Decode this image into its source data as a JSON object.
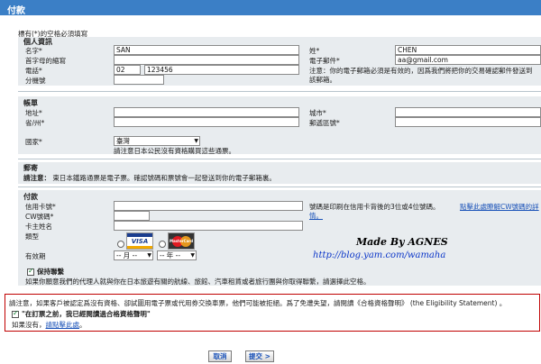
{
  "title": "付款",
  "required_note": "標有(*)的空格必須填寫",
  "personal": {
    "section_title": "個人資訊",
    "first_name_label": "名字*",
    "first_name_value": "SAN",
    "initial_label": "首字母的縮寫",
    "phone_label": "電話*",
    "phone_area": "02",
    "phone_number": "123456",
    "ext_label": "分機號",
    "last_name_label": "姓*",
    "last_name_value": "CHEN",
    "email_label": "電子郵件*",
    "email_value": "aa@gmail.com",
    "email_note_a": "注意：你的電子郵箱必須是有效的，因爲我們將把你的交易確認郵件發送到",
    "email_note_b": "該郵箱。"
  },
  "billing": {
    "section_title": "帳單",
    "address_label": "地址*",
    "province_label": "省/州*",
    "city_label": "城市*",
    "postal_label": "郵遞區號*",
    "country_label": "國家*",
    "country_value": "臺灣",
    "country_note": "請注意日本公民沒有資格購買這些通票。"
  },
  "delivery": {
    "section_title": "郵寄",
    "note_bold": "請注意：",
    "note_text": "東日本鐵路通票是電子票。確認號碼和票號會一起發送到你的電子郵箱裏。"
  },
  "payment": {
    "section_title": "付款",
    "card_number_label": "信用卡號*",
    "cvv_label": "CW號碼*",
    "card_name_label": "卡主姓名",
    "card_type_label": "類型",
    "expiry_label": "有效期",
    "month_placeholder": "-- 月 --",
    "year_placeholder": "-- 年 --",
    "cvv_note": "號碼是印刷在信用卡背後的3位或4位號碼。",
    "cvv_link_a": "點擊此處瞭解CW號碼的詳",
    "cvv_link_b": "情。",
    "visa_label": "VISA",
    "mastercard_label": "MasterCard",
    "keep_contact_label": "保持聯繫",
    "keep_contact_note": "如果你願意我們的代理人就與你在日本旅遊有關的航線、旅館、汽車租賃或者旅行團與你取得聯繫，請選擇此空格。"
  },
  "watermark": {
    "line1": "Made By AGNES",
    "line2": "http://blog.yam.com/wamaha"
  },
  "eligibility": {
    "notice": "請注意，如果客戶被認定爲沒有資格、卻試圖用電子票或代用券交換車票，他們可能被拒絕。爲了免遭失望，請閱讀《合格資格聲明》 (the Eligibility Statement) 。",
    "confirm_label": "\"在訂票之前，我已經閱讀過合格資格聲明\"",
    "no_prefix": "如果沒有，",
    "read_link": "請點擊此處",
    "suffix": "。"
  },
  "buttons": {
    "cancel": "取消",
    "submit": "提交 >"
  }
}
